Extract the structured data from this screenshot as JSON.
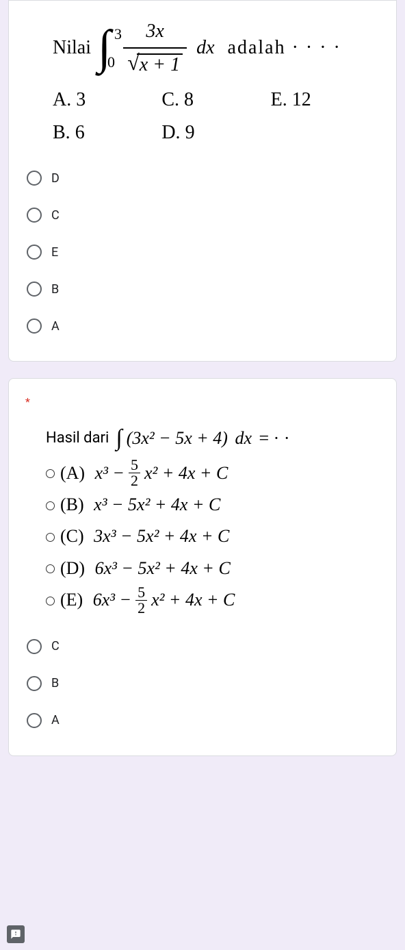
{
  "q1": {
    "stem_prefix": "Nilai",
    "integral": {
      "lower": "0",
      "upper": "3",
      "numerator": "3x",
      "under_sqrt": "x + 1",
      "dx": "dx"
    },
    "stem_suffix": "adalah · · · ·",
    "answer_choices": {
      "A": "3",
      "B": "6",
      "C": "8",
      "D": "9",
      "E": "12"
    },
    "answer_labels": {
      "A": "A. ",
      "B": "B. ",
      "C": "C. ",
      "D": "D. ",
      "E": "E. "
    },
    "options": [
      "D",
      "C",
      "E",
      "B",
      "A"
    ]
  },
  "q2": {
    "required_mark": "*",
    "stem_prefix": "Hasil dari",
    "integrand": "(3x² − 5x + 4)",
    "dx": "dx",
    "equals": "= · ·",
    "choices": {
      "A": {
        "label": "(A)",
        "pre": "x³ − ",
        "frac_n": "5",
        "frac_d": "2",
        "post": "x² + 4x + C"
      },
      "B": {
        "label": "(B)",
        "text": "x³ − 5x² + 4x + C"
      },
      "C": {
        "label": "(C)",
        "text": "3x³ − 5x² + 4x + C"
      },
      "D": {
        "label": "(D)",
        "text": "6x³ − 5x² + 4x + C"
      },
      "E": {
        "label": "(E)",
        "pre": "6x³ − ",
        "frac_n": "5",
        "frac_d": "2",
        "post": "x² + 4x + C"
      }
    },
    "options": [
      "C",
      "B",
      "A"
    ]
  }
}
